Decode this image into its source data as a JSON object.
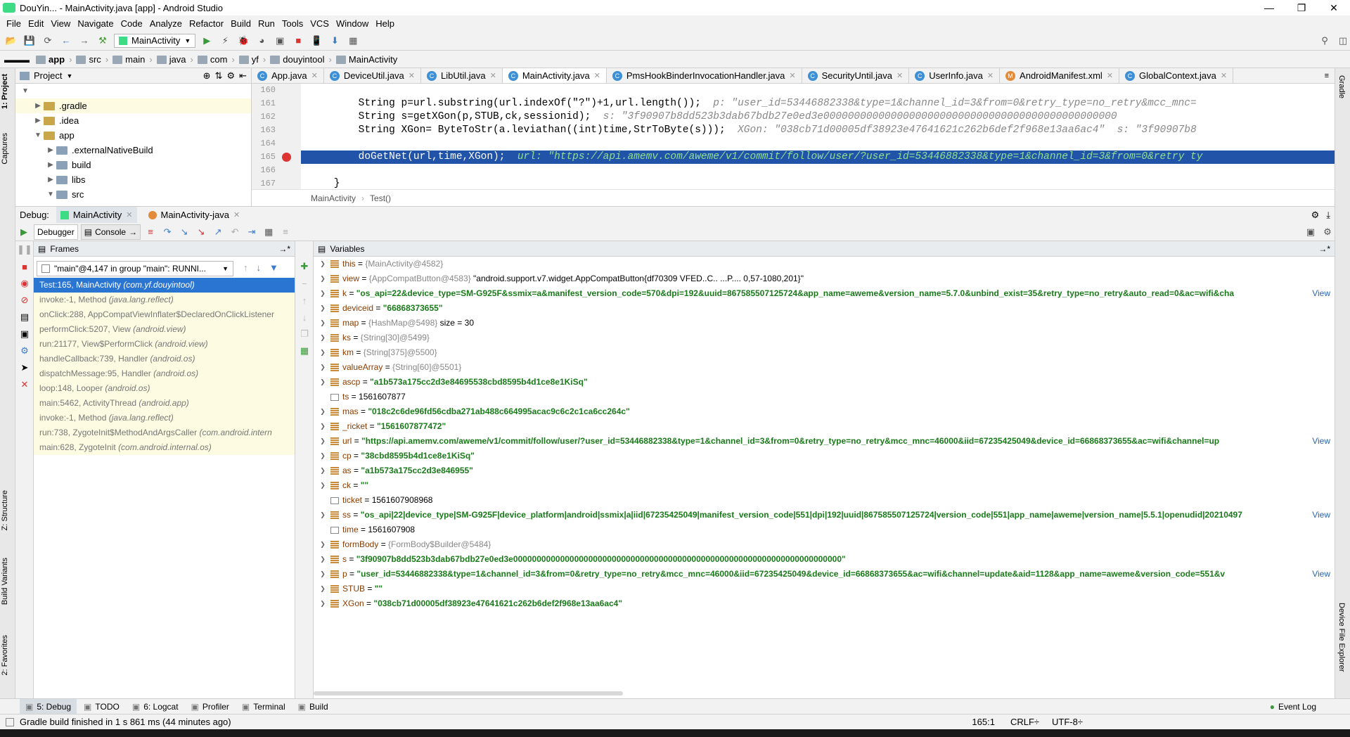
{
  "window": {
    "title": "DouYin... - MainActivity.java [app] - Android Studio",
    "min": "—",
    "max": "❐",
    "close": "✕"
  },
  "menu": [
    "File",
    "Edit",
    "View",
    "Navigate",
    "Code",
    "Analyze",
    "Refactor",
    "Build",
    "Run",
    "Tools",
    "VCS",
    "Window",
    "Help"
  ],
  "toolbar": {
    "run_config": "MainActivity"
  },
  "breadcrumbs": [
    "app",
    "src",
    "main",
    "java",
    "com",
    "yf",
    "douyintool",
    "MainActivity"
  ],
  "project": {
    "header": "Project",
    "tree": [
      {
        "label": ".gradle",
        "depth": 1,
        "expanded": false,
        "folder": "y"
      },
      {
        "label": ".idea",
        "depth": 1,
        "expanded": false,
        "folder": "y"
      },
      {
        "label": "app",
        "depth": 1,
        "expanded": true,
        "folder": "y"
      },
      {
        "label": ".externalNativeBuild",
        "depth": 2,
        "expanded": false,
        "folder": "b"
      },
      {
        "label": "build",
        "depth": 2,
        "expanded": false,
        "folder": "b"
      },
      {
        "label": "libs",
        "depth": 2,
        "expanded": false,
        "folder": "b"
      },
      {
        "label": "src",
        "depth": 2,
        "expanded": true,
        "folder": "b"
      }
    ]
  },
  "editor_tabs": [
    {
      "label": "App.java",
      "active": false
    },
    {
      "label": "DeviceUtil.java",
      "active": false
    },
    {
      "label": "LibUtil.java",
      "active": false
    },
    {
      "label": "MainActivity.java",
      "active": true
    },
    {
      "label": "PmsHookBinderInvocationHandler.java",
      "active": false
    },
    {
      "label": "SecurityUntil.java",
      "active": false
    },
    {
      "label": "UserInfo.java",
      "active": false
    },
    {
      "label": "AndroidManifest.xml",
      "active": false
    },
    {
      "label": "GlobalContext.java",
      "active": false
    }
  ],
  "code": {
    "lines": [
      {
        "n": "160",
        "code": "",
        "comment": ""
      },
      {
        "n": "161",
        "code": "        String p=url.substring(url.indexOf(\"?\")+1,url.length());",
        "comment": "  p: \"user_id=53446882338&type=1&channel_id=3&from=0&retry_type=no_retry&mcc_mnc="
      },
      {
        "n": "162",
        "code": "        String s=getXGon(p,STUB,ck,sessionid);",
        "comment": "  s: \"3f90907b8dd523b3dab67bdb27e0ed3e000000000000000000000000000000000000000000000000"
      },
      {
        "n": "163",
        "code": "        String XGon= ByteToStr(a.leviathan((int)time,StrToByte(s)));",
        "comment": "  XGon: \"038cb71d00005df38923e47641621c262b6def2f968e13aa6ac4\"  s: \"3f90907b8"
      },
      {
        "n": "164",
        "code": "",
        "comment": ""
      },
      {
        "n": "165",
        "code": "        doGetNet(url,time,XGon);",
        "comment": "  url: \"https://api.amemv.com/aweme/v1/commit/follow/user/?user_id=53446882338&type=1&channel_id=3&from=0&retry ty"
      },
      {
        "n": "166",
        "code": "",
        "comment": ""
      },
      {
        "n": "167",
        "code": "    }",
        "comment": ""
      }
    ],
    "highlight_line": "165",
    "footer": [
      "MainActivity",
      "Test()"
    ]
  },
  "debug": {
    "label": "Debug:",
    "tabs": [
      "MainActivity",
      "MainActivity-java"
    ],
    "subtabs": [
      "Debugger",
      "Console"
    ]
  },
  "frames": {
    "title": "Frames",
    "thread": "\"main\"@4,147 in group \"main\": RUNNI...",
    "items": [
      {
        "text": "Test:165, MainActivity ",
        "pkg": "(com.yf.douyintool)",
        "sel": true
      },
      {
        "text": "invoke:-1, Method ",
        "pkg": "(java.lang.reflect)",
        "sel": false
      },
      {
        "text": "onClick:288, AppCompatViewInflater$DeclaredOnClickListener",
        "pkg": "",
        "sel": false
      },
      {
        "text": "performClick:5207, View ",
        "pkg": "(android.view)",
        "sel": false
      },
      {
        "text": "run:21177, View$PerformClick ",
        "pkg": "(android.view)",
        "sel": false
      },
      {
        "text": "handleCallback:739, Handler ",
        "pkg": "(android.os)",
        "sel": false
      },
      {
        "text": "dispatchMessage:95, Handler ",
        "pkg": "(android.os)",
        "sel": false
      },
      {
        "text": "loop:148, Looper ",
        "pkg": "(android.os)",
        "sel": false
      },
      {
        "text": "main:5462, ActivityThread ",
        "pkg": "(android.app)",
        "sel": false
      },
      {
        "text": "invoke:-1, Method ",
        "pkg": "(java.lang.reflect)",
        "sel": false
      },
      {
        "text": "run:738, ZygoteInit$MethodAndArgsCaller ",
        "pkg": "(com.android.intern",
        "sel": false
      },
      {
        "text": "main:628, ZygoteInit ",
        "pkg": "(com.android.internal.os)",
        "sel": false
      }
    ]
  },
  "variables": {
    "title": "Variables",
    "items": [
      {
        "name": "this",
        "ref": "{MainActivity@4582}",
        "value": "",
        "kind": "obj",
        "exp": true,
        "view": ""
      },
      {
        "name": "view",
        "ref": "{AppCompatButton@4583}",
        "value": "\"android.support.v7.widget.AppCompatButton{df70309 VFED..C.. ...P.... 0,57-1080,201}\"",
        "kind": "plain",
        "exp": true,
        "view": ""
      },
      {
        "name": "k",
        "ref": "",
        "value": "\"os_api=22&device_type=SM-G925F&ssmix=a&manifest_version_code=570&dpi=192&uuid=867585507125724&app_name=aweme&version_name=5.7.0&unbind_exist=35&retry_type=no_retry&auto_read=0&ac=wifi&cha",
        "kind": "str",
        "exp": true,
        "view": "View"
      },
      {
        "name": "deviceid",
        "ref": "",
        "value": "\"66868373655\"",
        "kind": "str",
        "exp": true,
        "view": ""
      },
      {
        "name": "map",
        "ref": "{HashMap@5498}",
        "value": " size = 30",
        "kind": "plain",
        "exp": true,
        "view": ""
      },
      {
        "name": "ks",
        "ref": "{String[30]@5499}",
        "value": "",
        "kind": "obj",
        "exp": true,
        "view": ""
      },
      {
        "name": "km",
        "ref": "{String[375]@5500}",
        "value": "",
        "kind": "obj",
        "exp": true,
        "view": ""
      },
      {
        "name": "valueArray",
        "ref": "{String[60]@5501}",
        "value": "",
        "kind": "obj",
        "exp": true,
        "view": ""
      },
      {
        "name": "ascp",
        "ref": "",
        "value": "\"a1b573a175cc2d3e84695538cbd8595b4d1ce8e1KiSq\"",
        "kind": "str",
        "exp": true,
        "view": ""
      },
      {
        "name": "ts",
        "ref": "",
        "value": "1561607877",
        "kind": "num",
        "exp": false,
        "view": ""
      },
      {
        "name": "mas",
        "ref": "",
        "value": "\"018c2c6de96fd56cdba271ab488c664995acac9c6c2c1ca6cc264c\"",
        "kind": "str",
        "exp": true,
        "view": ""
      },
      {
        "name": "_ricket",
        "ref": "",
        "value": "\"1561607877472\"",
        "kind": "str",
        "exp": true,
        "view": ""
      },
      {
        "name": "url",
        "ref": "",
        "value": "\"https://api.amemv.com/aweme/v1/commit/follow/user/?user_id=53446882338&type=1&channel_id=3&from=0&retry_type=no_retry&mcc_mnc=46000&iid=67235425049&device_id=66868373655&ac=wifi&channel=up",
        "kind": "str",
        "exp": true,
        "view": "View"
      },
      {
        "name": "cp",
        "ref": "",
        "value": "\"38cbd8595b4d1ce8e1KiSq\"",
        "kind": "str",
        "exp": true,
        "view": ""
      },
      {
        "name": "as",
        "ref": "",
        "value": "\"a1b573a175cc2d3e846955\"",
        "kind": "str",
        "exp": true,
        "view": ""
      },
      {
        "name": "ck",
        "ref": "",
        "value": "\"\"",
        "kind": "str",
        "exp": true,
        "view": ""
      },
      {
        "name": "ticket",
        "ref": "",
        "value": "1561607908968",
        "kind": "num",
        "exp": false,
        "view": ""
      },
      {
        "name": "ss",
        "ref": "",
        "value": "\"os_api|22|device_type|SM-G925F|device_platform|android|ssmix|a|iid|67235425049|manifest_version_code|551|dpi|192|uuid|867585507125724|version_code|551|app_name|aweme|version_name|5.5.1|openudid|20210497",
        "kind": "str",
        "exp": true,
        "view": "View"
      },
      {
        "name": "time",
        "ref": "",
        "value": "1561607908",
        "kind": "num",
        "exp": false,
        "view": ""
      },
      {
        "name": "formBody",
        "ref": "{FormBody$Builder@5484}",
        "value": "",
        "kind": "obj",
        "exp": true,
        "view": ""
      },
      {
        "name": "s",
        "ref": "",
        "value": "\"3f90907b8dd523b3dab67bdb27e0ed3e0000000000000000000000000000000000000000000000000000000000000000000000\"",
        "kind": "str",
        "exp": true,
        "view": ""
      },
      {
        "name": "p",
        "ref": "",
        "value": "\"user_id=53446882338&type=1&channel_id=3&from=0&retry_type=no_retry&mcc_mnc=46000&iid=67235425049&device_id=66868373655&ac=wifi&channel=update&aid=1128&app_name=aweme&version_code=551&v",
        "kind": "str",
        "exp": true,
        "view": "View"
      },
      {
        "name": "STUB",
        "ref": "",
        "value": "\"\"",
        "kind": "str",
        "exp": true,
        "view": ""
      },
      {
        "name": "XGon",
        "ref": "",
        "value": "\"038cb71d00005df38923e47641621c262b6def2f968e13aa6ac4\"",
        "kind": "str",
        "exp": true,
        "view": ""
      }
    ]
  },
  "left_strip": [
    "1: Project",
    "Captures",
    "Z: Structure",
    "Build Variants",
    "2: Favorites"
  ],
  "right_strip": [
    "Gradle",
    "Device File Explorer"
  ],
  "bottom_tabs": [
    {
      "label": "5: Debug",
      "active": true
    },
    {
      "label": "TODO",
      "active": false
    },
    {
      "label": "6: Logcat",
      "active": false
    },
    {
      "label": "Profiler",
      "active": false
    },
    {
      "label": "Terminal",
      "active": false
    },
    {
      "label": "Build",
      "active": false
    }
  ],
  "event_log": "Event Log",
  "status": {
    "message": "Gradle build finished in 1 s 861 ms (44 minutes ago)",
    "position": "165:1",
    "line_sep": "CRLF÷",
    "encoding": "UTF-8÷"
  },
  "colors": {
    "selection": "#2154a8",
    "frame_selected": "#2a74d2",
    "string_value": "#1a7a1a",
    "var_name": "#8a3b00"
  }
}
